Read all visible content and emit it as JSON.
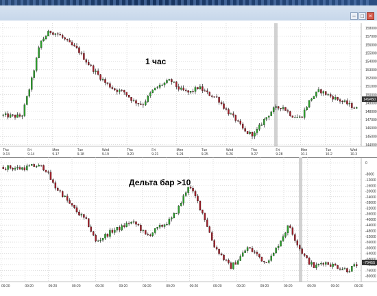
{
  "window": {
    "buttons": [
      "minimize",
      "maximize",
      "close"
    ],
    "accent": "#1f3c68"
  },
  "chart_top": {
    "annotation": "1 час",
    "price_ticks": [
      "158000",
      "157000",
      "156000",
      "155000",
      "154000",
      "153000",
      "152000",
      "151000",
      "150000",
      "149000",
      "148000",
      "147000",
      "146000",
      "145000",
      "144000"
    ],
    "current_price": "149450",
    "date_axis": [
      [
        "Thu",
        "9-13"
      ],
      [
        "Fri",
        "9-14"
      ],
      [
        "Mon",
        "9-17"
      ],
      [
        "Tue",
        "9-18"
      ],
      [
        "Wed",
        "9-19"
      ],
      [
        "Thu",
        "9-20"
      ],
      [
        "Fri",
        "9-21"
      ],
      [
        "Mon",
        "9-24"
      ],
      [
        "Tue",
        "9-25"
      ],
      [
        "Wed",
        "9-26"
      ],
      [
        "Thu",
        "9-27"
      ],
      [
        "Fri",
        "9-28"
      ],
      [
        "Mon",
        "10-1"
      ],
      [
        "Tue",
        "10-2"
      ],
      [
        "Wed",
        "10-3"
      ]
    ],
    "colors": {
      "up": "#2ca02c",
      "down": "#a0202a",
      "wick": "#000000",
      "grid": "#c9c9c9",
      "tag": "#333333"
    }
  },
  "chart_bottom": {
    "annotation": "Дельта бар >10",
    "value_ticks": [
      "0",
      "-8000",
      "-12000",
      "-16000",
      "-20000",
      "-24000",
      "-28000",
      "-32000",
      "-36000",
      "-40000",
      "-44000",
      "-48000",
      "-52000",
      "-56000",
      "-60000",
      "-64000",
      "-68000",
      "-72000",
      "-76000",
      "-80000"
    ],
    "current_value": "-70455",
    "time_axis": [
      "09:20",
      "09:20",
      "09:20",
      "09:20",
      "09:20",
      "09:20",
      "09:20",
      "09:20",
      "09:20",
      "09:20",
      "09:20",
      "09:20",
      "09:20",
      "09:20",
      "09:20",
      "09:20"
    ]
  },
  "chart_data": [
    {
      "type": "candlestick",
      "title": "1 час",
      "x": [
        "Thu 9-13",
        "Fri 9-14",
        "Mon 9-17",
        "Tue 9-18",
        "Wed 9-19",
        "Thu 9-20",
        "Fri 9-21",
        "Mon 9-24",
        "Tue 9-25",
        "Wed 9-26",
        "Thu 9-27",
        "Fri 9-28",
        "Mon 10-1",
        "Tue 10-2",
        "Wed 10-3"
      ],
      "close": [
        147500,
        157000,
        156200,
        153600,
        150800,
        150600,
        151800,
        150300,
        150600,
        146500,
        148600,
        147300,
        150600,
        149200,
        147600
      ],
      "ylim": [
        143800,
        158400
      ],
      "last_value": 149450
    },
    {
      "type": "bar",
      "title": "Дельта бар >10",
      "x": [
        "Thu 9-13",
        "Fri 9-14",
        "Mon 9-17",
        "Tue 9-18",
        "Wed 9-19",
        "Thu 9-20",
        "Fri 9-21",
        "Mon 9-24",
        "Tue 9-25",
        "Wed 9-26",
        "Thu 9-27",
        "Fri 9-28",
        "Mon 10-1",
        "Tue 10-2",
        "Wed 10-3"
      ],
      "values": [
        -4000,
        -2500,
        -15000,
        -30000,
        -57000,
        -50000,
        -47000,
        -58000,
        -30000,
        -60000,
        -70000,
        -64000,
        -55000,
        -71000,
        -72000
      ],
      "ylim": [
        -84000,
        2000
      ],
      "last_value": -70455
    }
  ]
}
